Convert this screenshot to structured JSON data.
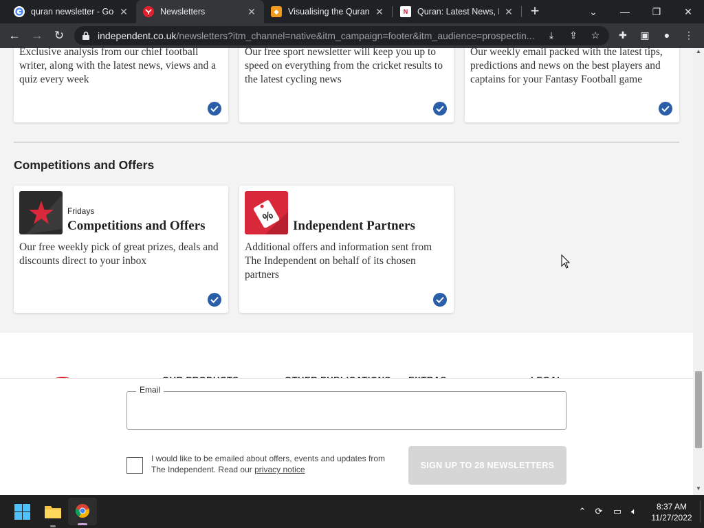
{
  "browser": {
    "tabs": [
      {
        "title": "quran newsletter - Goo",
        "favicon": "google-icon",
        "active": false
      },
      {
        "title": "Newsletters",
        "favicon": "independent-icon",
        "active": true
      },
      {
        "title": "Visualising the Quran |",
        "favicon": "orange-site-icon",
        "active": false
      },
      {
        "title": "Quran: Latest News, Ph",
        "favicon": "n-site-icon",
        "active": false
      }
    ],
    "url_host": "independent.co.uk",
    "url_path": "/newsletters?itm_channel=native&itm_campaign=footer&itm_audience=prospectin..."
  },
  "page": {
    "top_cards": [
      {
        "desc": "Exclusive analysis from our chief football writer, along with the latest news, views and a quiz every week"
      },
      {
        "desc": "Our free sport newsletter will keep you up to speed on everything from the cricket results to the latest cycling news"
      },
      {
        "desc": "Our weekly email packed with the latest tips, predictions and news on the best players and captains for your Fantasy Football game"
      }
    ],
    "section_title": "Competitions and Offers",
    "cards": [
      {
        "frequency": "Fridays",
        "title": "Competitions and Offers",
        "desc": "Our free weekly pick of great prizes, deals and discounts direct to your inbox"
      },
      {
        "frequency": "",
        "title": "Independent Partners",
        "desc": "Additional offers and information sent from The Independent on behalf of its chosen partners"
      }
    ],
    "footer_headings": [
      "OUR PRODUCTS",
      "OTHER PUBLICATIONS",
      "EXTRAS",
      "LEGAL"
    ]
  },
  "signup": {
    "email_label": "Email",
    "email_value": "",
    "consent_text": "I would like to be emailed about offers, events and updates from The Independent. Read our ",
    "privacy_link": "privacy notice",
    "button_label": "SIGN UP TO 28 NEWSLETTERS"
  },
  "taskbar": {
    "time": "8:37 AM",
    "date": "11/27/2022"
  },
  "colors": {
    "accent_blue": "#2a5ea9",
    "brand_red": "#e4202e",
    "button_disabled": "#d6d6d6"
  }
}
